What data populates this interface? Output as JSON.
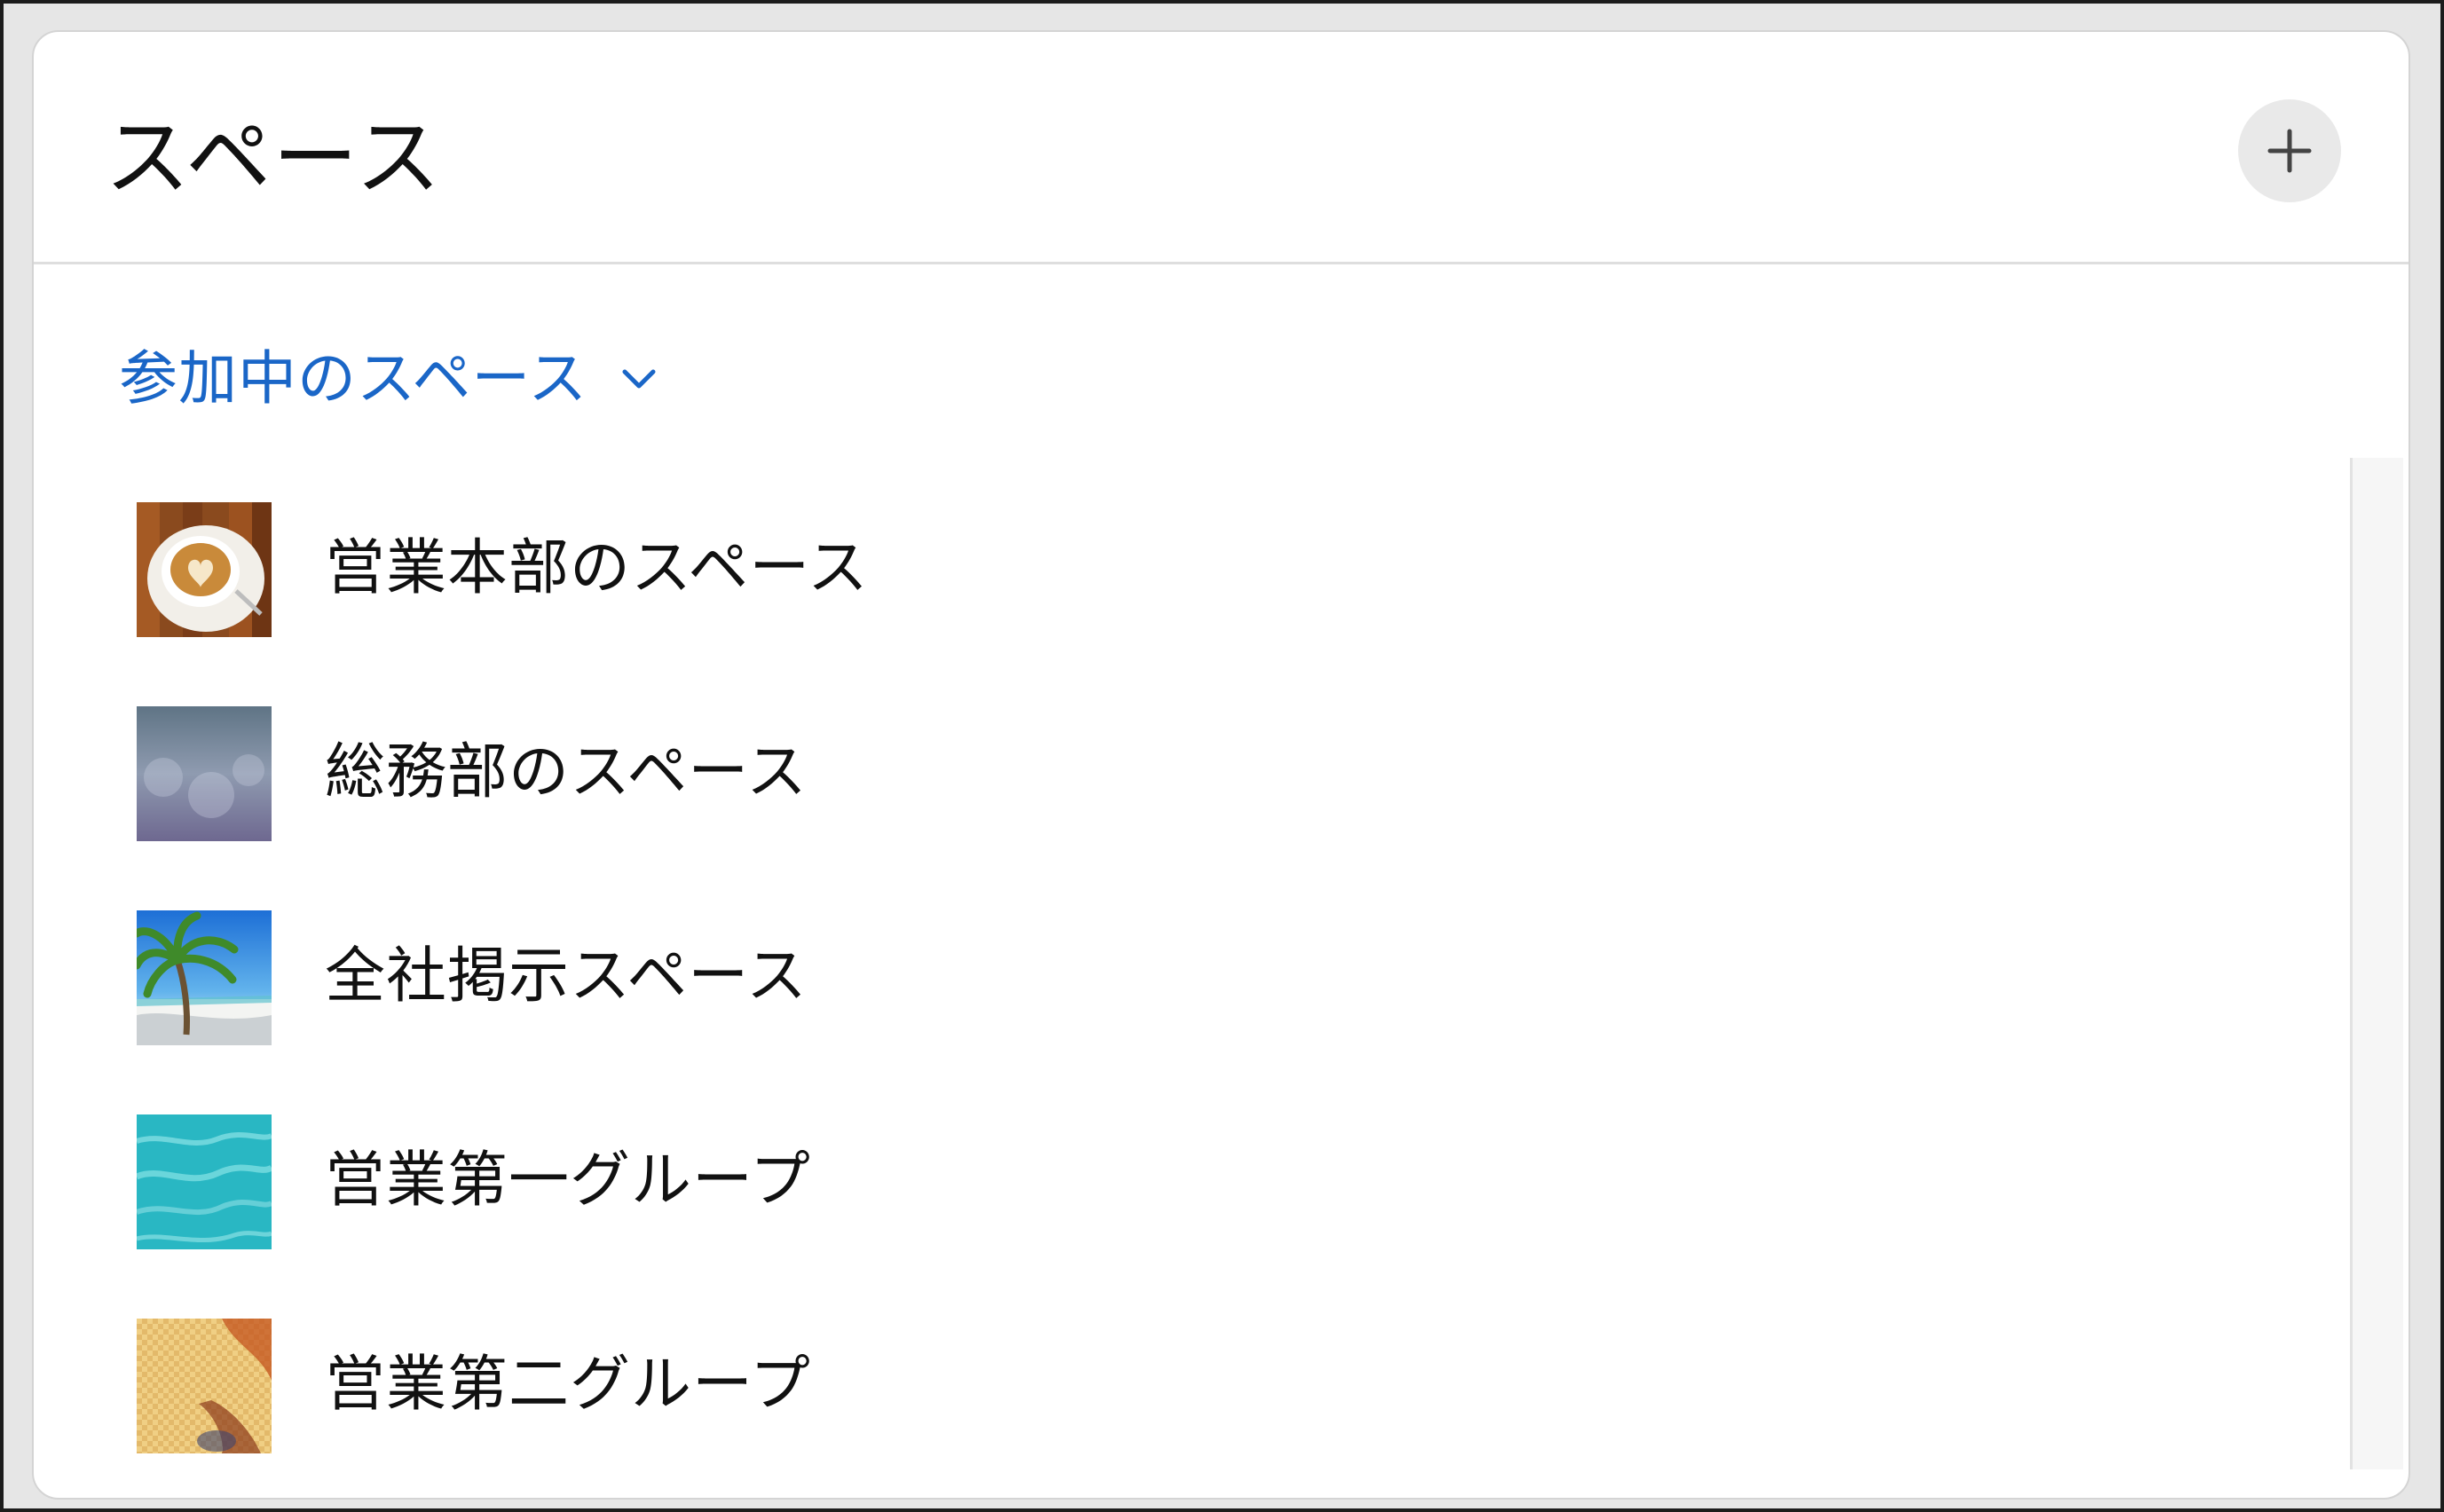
{
  "header": {
    "title": "スペース",
    "add_icon": "plus-icon"
  },
  "filter": {
    "label": "参加中のスペース",
    "icon": "chevron-down-icon",
    "color": "#1a66c7"
  },
  "spaces": [
    {
      "name": "営業本部のスペース",
      "thumbnail": "coffee-latte-art"
    },
    {
      "name": "総務部のスペース",
      "thumbnail": "blue-gray-bokeh"
    },
    {
      "name": "全社掲示スペース",
      "thumbnail": "beach-palm-tree"
    },
    {
      "name": "営業第一グループ",
      "thumbnail": "turquoise-water"
    },
    {
      "name": "営業第二グループ",
      "thumbnail": "woven-texture-orange"
    }
  ]
}
